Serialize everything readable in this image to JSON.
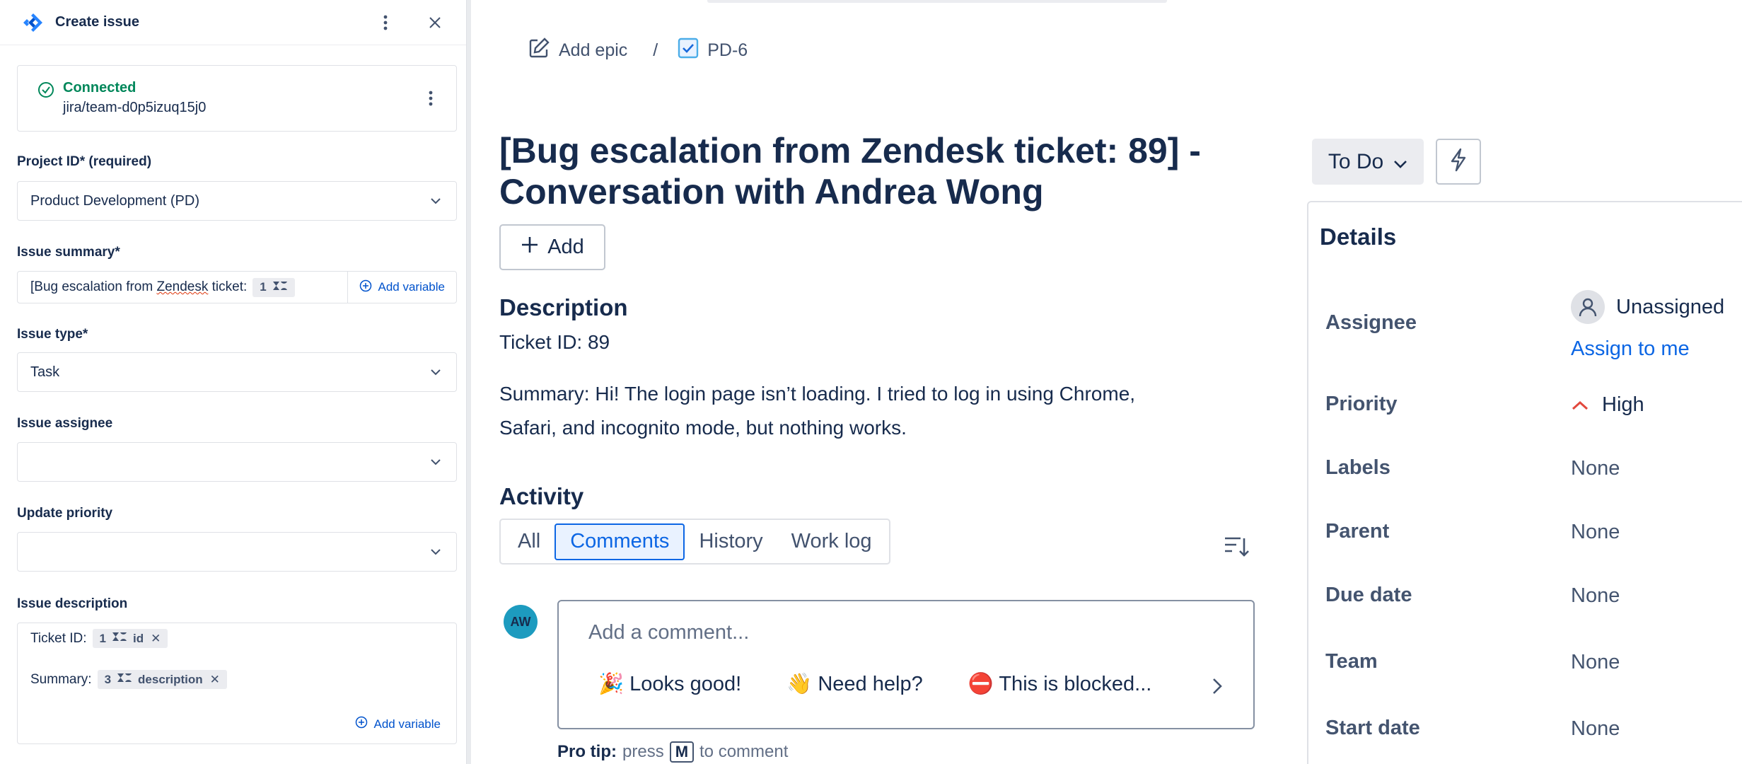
{
  "panel": {
    "title": "Create issue",
    "connection": {
      "status": "Connected",
      "path": "jira/team-d0p5izuq15j0"
    },
    "project": {
      "label": "Project ID* (required)",
      "value": "Product Development (PD)"
    },
    "summary": {
      "label": "Issue summary*",
      "text_before": "[Bug escalation from ",
      "text_misspelled": "Zendesk",
      "text_after": " ticket:",
      "pill_number": "1",
      "add_variable": "Add variable"
    },
    "issue_type": {
      "label": "Issue type*",
      "value": "Task"
    },
    "assignee": {
      "label": "Issue assignee",
      "value": ""
    },
    "priority": {
      "label": "Update priority",
      "value": ""
    },
    "description": {
      "label": "Issue description",
      "line1_label": "Ticket ID:",
      "line1_pill_number": "1",
      "line1_pill_text": "id",
      "line2_label": "Summary:",
      "line2_pill_number": "3",
      "line2_pill_text": "description",
      "add_variable": "Add variable"
    }
  },
  "breadcrumb": {
    "epic": "Add epic",
    "separator": "/",
    "issue_key": "PD-6"
  },
  "issue": {
    "title_line1": "[Bug escalation from Zendesk ticket: 89] -",
    "title_line2": "Conversation with Andrea Wong",
    "add_label": "Add",
    "description_heading": "Description",
    "ticket_line": "Ticket ID: 89",
    "summary_line1": "Summary: Hi! The login page isn’t loading. I tried to log in using Chrome,",
    "summary_line2": "Safari, and incognito mode, but nothing works."
  },
  "activity": {
    "heading": "Activity",
    "tabs": [
      "All",
      "Comments",
      "History",
      "Work log"
    ],
    "active_tab": "Comments",
    "avatar_initials": "AW",
    "comment_placeholder": "Add a comment...",
    "quick_replies": [
      "🎉 Looks good!",
      "👋 Need help?",
      "⛔ This is blocked..."
    ],
    "protip_label": "Pro tip:",
    "protip_press": "press",
    "protip_key": "M",
    "protip_rest": "to comment"
  },
  "status": {
    "label": "To Do"
  },
  "details": {
    "heading": "Details",
    "assignee_label": "Assignee",
    "assignee_value": "Unassigned",
    "assign_to_me": "Assign to me",
    "priority_label": "Priority",
    "priority_value": "High",
    "labels_label": "Labels",
    "labels_value": "None",
    "parent_label": "Parent",
    "parent_value": "None",
    "due_label": "Due date",
    "due_value": "None",
    "team_label": "Team",
    "team_value": "None",
    "start_label": "Start date",
    "start_value": "None"
  },
  "colors": {
    "accent": "#0c66e4",
    "connected": "#00875a",
    "priority_high": "#e2483d",
    "avatar": "#1d9bbf"
  },
  "icons": [
    "jira-logo-icon",
    "more-vertical-icon",
    "close-icon",
    "check-circle-icon",
    "chevron-down-icon",
    "zendesk-icon",
    "plus-circle-icon",
    "edit-icon",
    "checkbox-icon",
    "plus-icon",
    "sort-icon",
    "chevron-right-icon",
    "bolt-icon",
    "user-icon",
    "priority-high-icon"
  ]
}
